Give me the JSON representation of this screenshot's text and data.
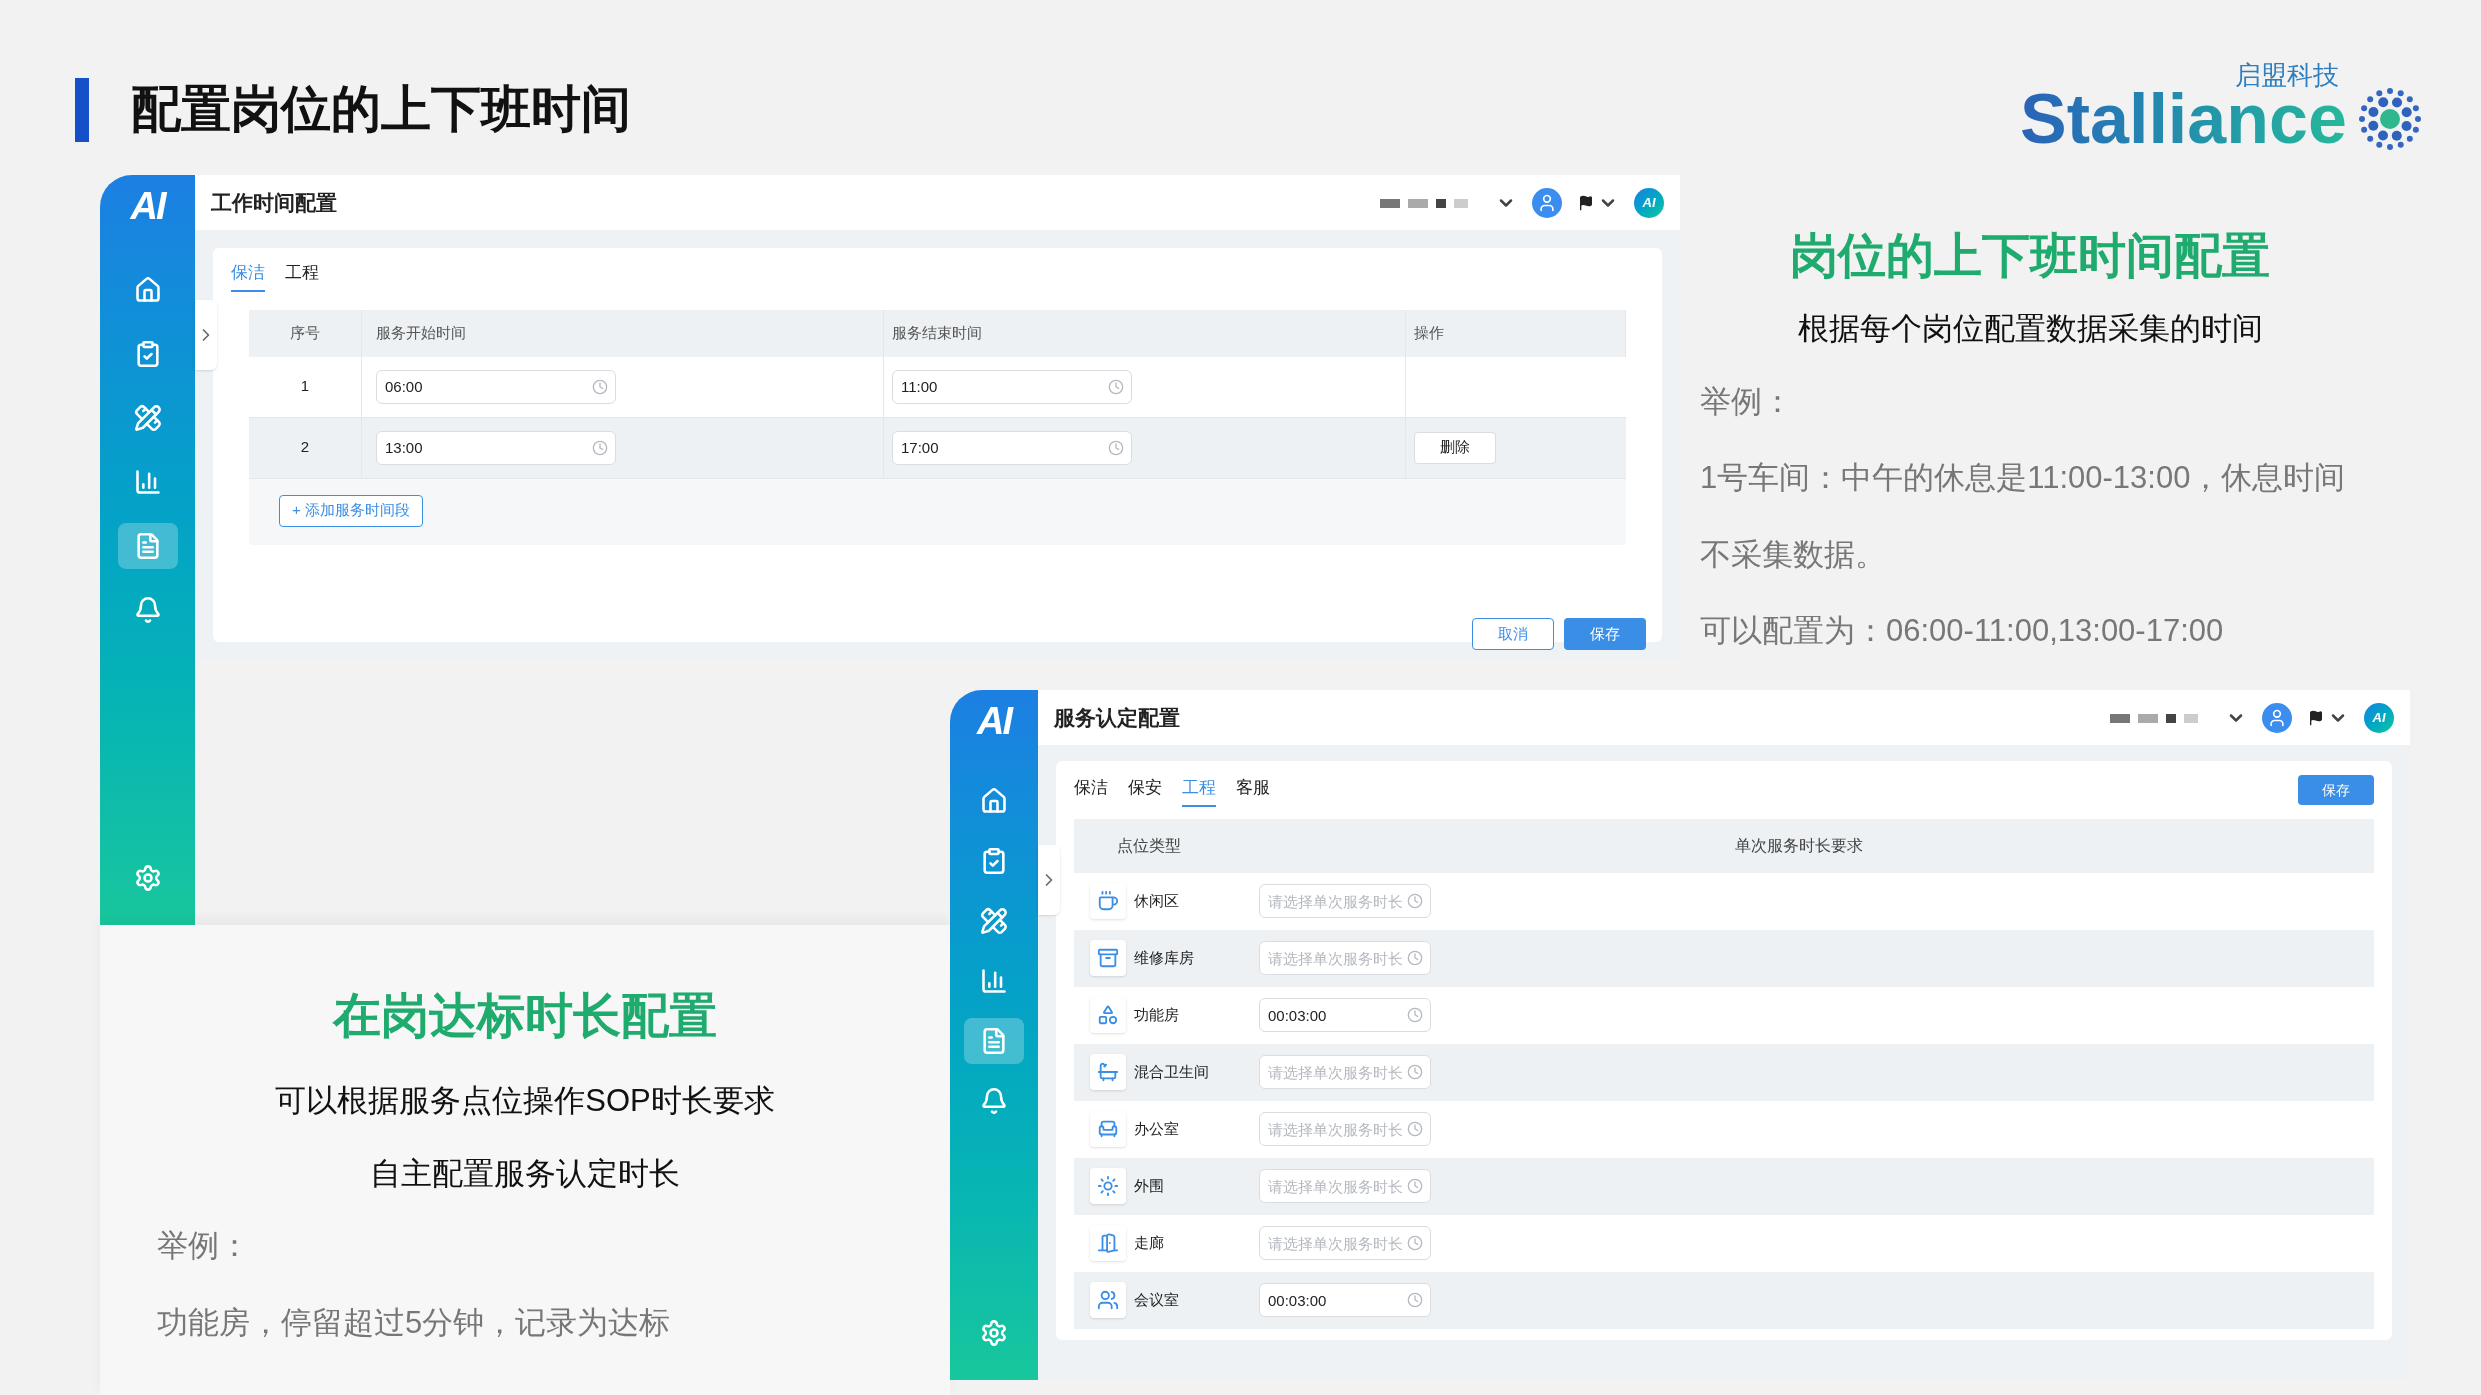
{
  "slide_title": "配置岗位的上下班时间",
  "logo": {
    "wordmark": "Stalliance",
    "tagline": "启盟科技"
  },
  "work_time_window": {
    "sidebar_logo": "AI",
    "title": "工作时间配置",
    "header_logo": "AI",
    "sidebar": [
      {
        "kind": "home",
        "selected": false
      },
      {
        "kind": "tasks",
        "selected": false
      },
      {
        "kind": "tools",
        "selected": false
      },
      {
        "kind": "stats",
        "selected": false
      },
      {
        "kind": "list",
        "selected": true
      },
      {
        "kind": "alerts",
        "selected": false
      },
      {
        "kind": "settings",
        "selected": false
      }
    ],
    "tabs": [
      {
        "label": "保洁",
        "selected": true
      },
      {
        "label": "工程",
        "selected": false
      }
    ],
    "table": {
      "columns": [
        "序号",
        "服务开始时间",
        "服务结束时间",
        "操作"
      ],
      "rows": [
        {
          "index": "1",
          "start": "06:00",
          "end": "11:00"
        },
        {
          "index": "2",
          "start": "13:00",
          "end": "17:00",
          "action": "删除"
        }
      ]
    },
    "add_button": "+ 添加服务时间段",
    "cancel_button": "取消",
    "save_button": "保存"
  },
  "work_time_notes": {
    "heading": "岗位的上下班时间配置",
    "summary": "根据每个岗位配置数据采集的时间",
    "example_label": "举例：",
    "example_lines": [
      "1号车间：中午的休息是11:00-13:00，休息时间",
      "不采集数据。",
      "可以配置为：06:00-11:00,13:00-17:00"
    ]
  },
  "duration_notes": {
    "heading": "在岗达标时长配置",
    "summary_lines": [
      "可以根据服务点位操作SOP时长要求",
      "自主配置服务认定时长"
    ],
    "example_label": "举例：",
    "example": "功能房，停留超过5分钟，记录为达标"
  },
  "service_window": {
    "sidebar_logo": "AI",
    "title": "服务认定配置",
    "header_logo": "AI",
    "sidebar": [
      {
        "kind": "home",
        "selected": false
      },
      {
        "kind": "tasks",
        "selected": false
      },
      {
        "kind": "tools",
        "selected": false
      },
      {
        "kind": "stats",
        "selected": false
      },
      {
        "kind": "list",
        "selected": true
      },
      {
        "kind": "alerts",
        "selected": false
      },
      {
        "kind": "settings",
        "selected": false
      }
    ],
    "tabs": [
      {
        "label": "保洁",
        "selected": false
      },
      {
        "label": "保安",
        "selected": false
      },
      {
        "label": "工程",
        "selected": true
      },
      {
        "label": "客服",
        "selected": false
      }
    ],
    "save_button": "保存",
    "columns": [
      "点位类型",
      "单次服务时长要求"
    ],
    "rows": [
      {
        "kind": "lounge",
        "name": "休闲区",
        "placeholder": "请选择单次服务时长"
      },
      {
        "kind": "repair",
        "name": "维修库房",
        "placeholder": "请选择单次服务时长"
      },
      {
        "kind": "function",
        "name": "功能房",
        "value": "00:03:00"
      },
      {
        "kind": "restroom",
        "name": "混合卫生间",
        "placeholder": "请选择单次服务时长"
      },
      {
        "kind": "office",
        "name": "办公室",
        "placeholder": "请选择单次服务时长"
      },
      {
        "kind": "perimeter",
        "name": "外围",
        "placeholder": "请选择单次服务时长"
      },
      {
        "kind": "corridor",
        "name": "走廊",
        "placeholder": "请选择单次服务时长"
      },
      {
        "kind": "meeting",
        "name": "会议室",
        "value": "00:03:00"
      }
    ]
  }
}
